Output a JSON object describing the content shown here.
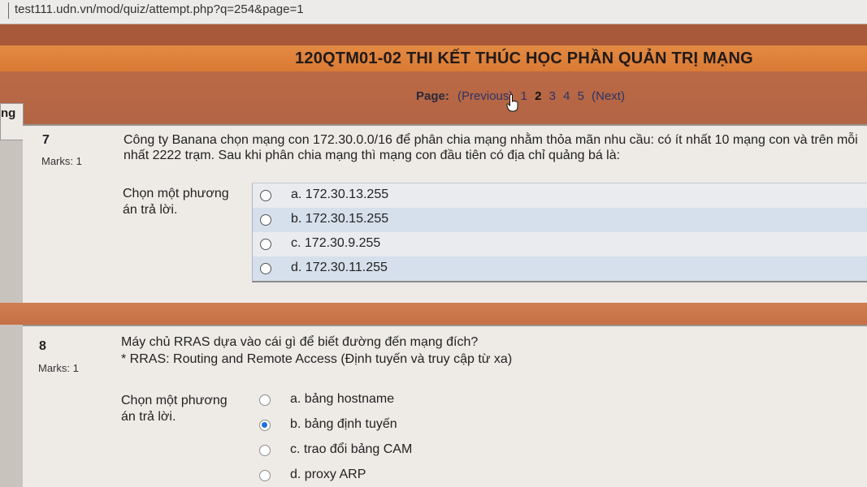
{
  "browser": {
    "url": "test111.udn.vn/mod/quiz/attempt.php?q=254&page=1"
  },
  "header": {
    "title": "120QTM01-02 THI KẾT THÚC HỌC PHẦN QUẢN TRỊ MẠNG"
  },
  "paging": {
    "label": "Page:",
    "previous": "(Previous)",
    "pages": [
      "1",
      "2",
      "3",
      "4",
      "5"
    ],
    "current": "2",
    "next": "(Next)"
  },
  "side_tab": {
    "text": "ng"
  },
  "questions": [
    {
      "number": "7",
      "marks": "Marks: 1",
      "text_line1": "Công ty Banana chọn mạng con 172.30.0.0/16 để phân chia mạng nhằm thỏa mãn nhu cầu: có ít nhất 10 mạng con và trên mỗi",
      "text_line2": "nhất 2222 trạm. Sau khi phân chia mạng thì mạng con đầu tiên có địa chỉ quảng bá là:",
      "prompt": "Chọn một phương án trả lời.",
      "options": [
        {
          "label": "a. 172.30.13.255",
          "selected": false
        },
        {
          "label": "b. 172.30.15.255",
          "selected": false
        },
        {
          "label": "c. 172.30.9.255",
          "selected": false
        },
        {
          "label": "d. 172.30.11.255",
          "selected": false
        }
      ]
    },
    {
      "number": "8",
      "marks": "Marks: 1",
      "text_line1": "Máy chủ RRAS dựa vào cái gì để biết đường đến mạng đích?",
      "text_line2": "* RRAS: Routing and Remote Access (Định tuyến và truy cập từ xa)",
      "prompt": "Chọn một phương án trả lời.",
      "options": [
        {
          "label": "a. bảng hostname",
          "selected": false
        },
        {
          "label": "b. bảng định tuyến",
          "selected": true
        },
        {
          "label": "c. trao đổi bảng CAM",
          "selected": false
        },
        {
          "label": "d. proxy ARP",
          "selected": false
        }
      ]
    }
  ],
  "icons": {
    "cursor": "hand-pointer-icon",
    "radio": "radio-button-icon"
  }
}
